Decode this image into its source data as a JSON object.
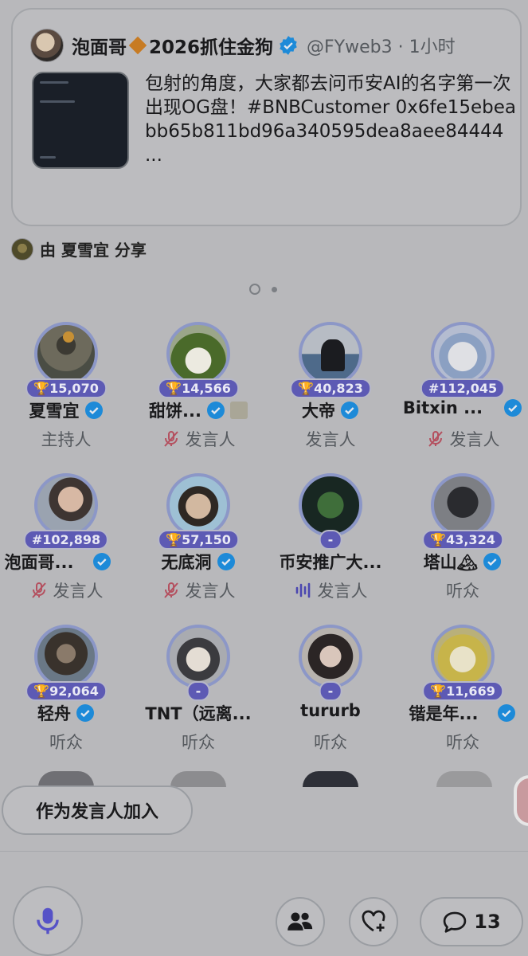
{
  "tweet": {
    "author_name": "泡面哥",
    "author_suffix": "2026抓住金狗",
    "handle_time": "@FYweb3 · 1小时",
    "text": "包射的角度，大家都去问币安AI的名字第一次出现OG盘！#BNBCustomer 0x6fe15ebeabb65b811bd96a340595dea8aee84444\n..."
  },
  "shared_by": "由 夏雪宜 分享",
  "participants": [
    {
      "name": "夏雪宜",
      "badge": "🏆15,070",
      "role": "主持人",
      "verified": true,
      "role_icon": "none"
    },
    {
      "name": "甜饼...",
      "badge": "🏆14,566",
      "role": "发言人",
      "verified": true,
      "role_icon": "mic-muted-icon"
    },
    {
      "name": "大帝",
      "badge": "🏆40,823",
      "role": "发言人",
      "verified": true,
      "role_icon": "none"
    },
    {
      "name": "Bitxin ...",
      "badge": "#112,045",
      "role": "发言人",
      "verified": true,
      "role_icon": "mic-muted-icon"
    },
    {
      "name": "泡面哥...",
      "badge": "#102,898",
      "role": "发言人",
      "verified": true,
      "role_icon": "mic-muted-icon"
    },
    {
      "name": "无底洞",
      "badge": "🏆57,150",
      "role": "发言人",
      "verified": true,
      "role_icon": "mic-muted-icon"
    },
    {
      "name": "币安推广大...",
      "badge": "-",
      "role": "发言人",
      "verified": false,
      "role_icon": "speaking-wave-icon"
    },
    {
      "name": "塔山🏔",
      "badge": "🏆43,324",
      "role": "听众",
      "verified": true,
      "role_icon": "none"
    },
    {
      "name": "轻舟",
      "badge": "🏆92,064",
      "role": "听众",
      "verified": true,
      "role_icon": "none"
    },
    {
      "name": "TNT（远离...",
      "badge": "-",
      "role": "听众",
      "verified": false,
      "role_icon": "none"
    },
    {
      "name": "tururb",
      "badge": "-",
      "role": "听众",
      "verified": false,
      "role_icon": "none"
    },
    {
      "name": "锴是年...",
      "badge": "🏆11,669",
      "role": "听众",
      "verified": true,
      "role_icon": "none"
    }
  ],
  "join_button": "作为发言人加入",
  "reply_count": "13",
  "colors": {
    "verified": "#1d9bf0",
    "accent": "#5d5ab4"
  }
}
